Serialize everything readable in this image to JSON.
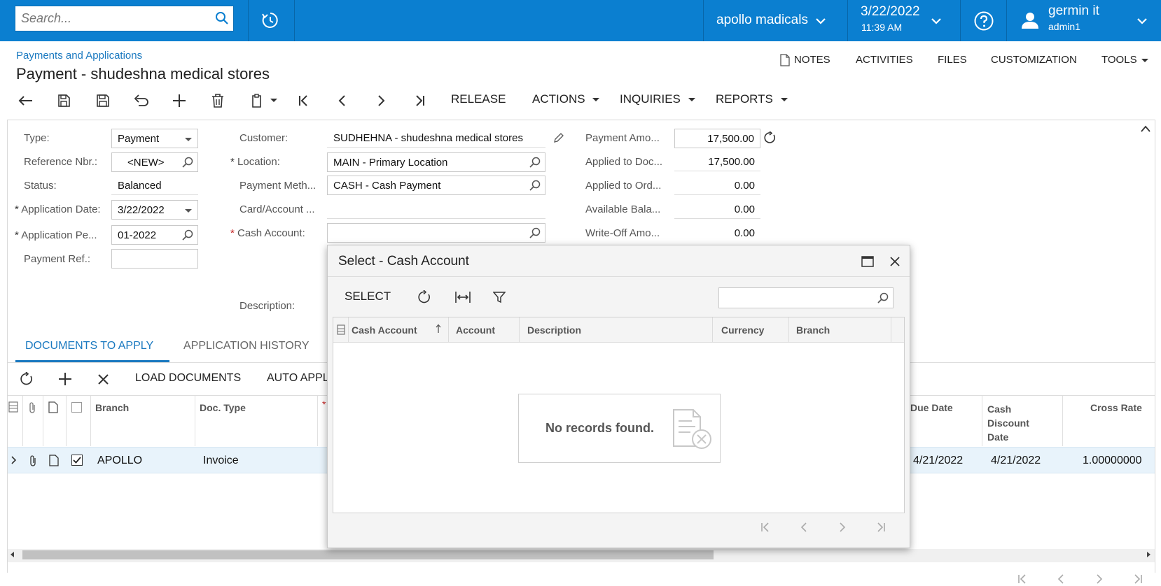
{
  "topbar": {
    "search_placeholder": "Search...",
    "company": "apollo madicals",
    "date": "3/22/2022",
    "time": "11:39 AM",
    "user_name": "germin it",
    "user_login": "admin1"
  },
  "breadcrumb": "Payments and Applications",
  "page_title": "Payment - shudeshna medical stores",
  "header_links": [
    "NOTES",
    "ACTIVITIES",
    "FILES",
    "CUSTOMIZATION",
    "TOOLS"
  ],
  "toolbar": {
    "release": "RELEASE",
    "actions": "ACTIONS",
    "inquiries": "INQUIRIES",
    "reports": "REPORTS"
  },
  "form": {
    "type_label": "Type:",
    "type_value": "Payment",
    "ref_label": "Reference Nbr.:",
    "ref_value": "<NEW>",
    "status_label": "Status:",
    "status_value": "Balanced",
    "appdate_label": "Application Date:",
    "appdate_value": "3/22/2022",
    "appperiod_label": "Application Pe...",
    "appperiod_value": "01-2022",
    "payref_label": "Payment Ref.:",
    "payref_value": "",
    "customer_label": "Customer:",
    "customer_value": "SUDHEHNA - shudeshna medical stores",
    "location_label": "Location:",
    "location_value": "MAIN - Primary Location",
    "paymeth_label": "Payment Meth...",
    "paymeth_value": "CASH - Cash Payment",
    "card_label": "Card/Account ...",
    "cash_label": "Cash Account:",
    "cash_value": "",
    "desc_label": "Description:",
    "payamt_label": "Payment Amo...",
    "payamt_value": "17,500.00",
    "applied_doc_label": "Applied to Doc...",
    "applied_doc_value": "17,500.00",
    "applied_ord_label": "Applied to Ord...",
    "applied_ord_value": "0.00",
    "avail_label": "Available Bala...",
    "avail_value": "0.00",
    "writeoff_label": "Write-Off Amo...",
    "writeoff_value": "0.00"
  },
  "tabs": [
    "DOCUMENTS TO APPLY",
    "APPLICATION HISTORY"
  ],
  "grid_toolbar": {
    "load": "LOAD DOCUMENTS",
    "auto": "AUTO APPL"
  },
  "grid": {
    "headers": {
      "branch": "Branch",
      "doctype": "Doc. Type",
      "due": "Due Date",
      "cashdisc": "Cash Discount Date",
      "cross": "Cross Rate"
    },
    "row": {
      "branch": "APOLLO",
      "doctype": "Invoice",
      "due": "4/21/2022",
      "cashdisc": "4/21/2022",
      "cross": "1.00000000"
    }
  },
  "dialog": {
    "title": "Select - Cash Account",
    "select": "SELECT",
    "search_value": "",
    "columns": [
      "Cash Account",
      "Account",
      "Description",
      "Currency",
      "Branch"
    ],
    "empty": "No records found."
  },
  "colors": {
    "topbar": "#0b7fd0",
    "link": "#1a79c0",
    "tab_active": "#1a79c0",
    "row_selected": "#e8f3fb"
  }
}
